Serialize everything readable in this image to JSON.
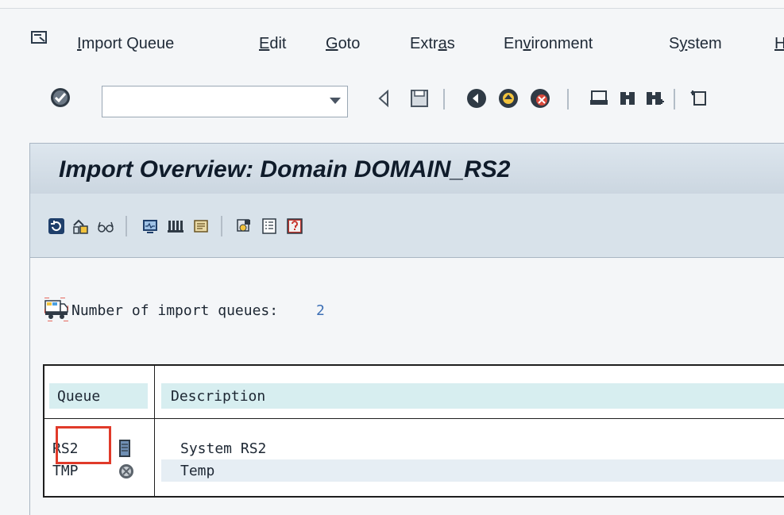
{
  "menu": {
    "items": [
      {
        "label": "Import Queue",
        "underline": "I"
      },
      {
        "label": "Edit",
        "underline": "E"
      },
      {
        "label": "Goto",
        "underline": "G"
      },
      {
        "label": "Extras",
        "underline": "a"
      },
      {
        "label": "Environment",
        "underline": "v"
      },
      {
        "label": "System",
        "underline": "y"
      },
      {
        "label": "H",
        "underline": "H"
      }
    ]
  },
  "toolbar": {
    "command_field_value": "",
    "icons": [
      "checkmark-icon",
      "back-triangle-icon",
      "save-icon",
      "back-icon",
      "exit-icon",
      "cancel-icon",
      "print-icon",
      "find-icon",
      "find-next-icon",
      "first-page-icon"
    ]
  },
  "screen": {
    "title": "Import Overview: Domain DOMAIN_RS2",
    "app_icons": [
      "refresh-icon",
      "display-icon",
      "glasses-icon",
      "monitor-icon",
      "queue-bars-icon",
      "scroll-icon",
      "system-icon",
      "list-icon",
      "help-icon"
    ]
  },
  "summary": {
    "label": "Number of import queues:",
    "value": "2"
  },
  "table": {
    "headers": {
      "queue": "Queue",
      "description": "Description"
    },
    "rows": [
      {
        "queue": "RS2",
        "description": "System RS2",
        "status_icon": "server-icon"
      },
      {
        "queue": "TMP",
        "description": "Temp",
        "status_icon": "stop-circle-icon"
      }
    ]
  },
  "colors": {
    "title_bg": "#cbd6e0",
    "header_cell_bg": "#d7eef0",
    "highlight_border": "#e03a2a"
  }
}
